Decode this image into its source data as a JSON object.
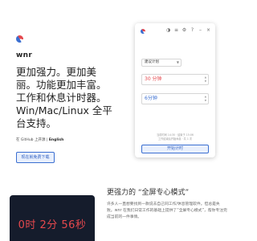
{
  "brand": "wnr",
  "headline": "更加强力。更加美丽。功能更加丰富。工作和休息计时器。Win/Mac/Linux 全平台支持。",
  "links": {
    "prefix": "在 GitHub 上开源 | ",
    "english": "English"
  },
  "download_button": "现在就免费下载",
  "app": {
    "select_value": "建议计划",
    "work_time": "30 分钟",
    "rest_time": "6分钟",
    "info_line1": "当前时间 14:30 · 结束于 15:06",
    "info_line2": "工作结束后开始休息 · 共 1 次",
    "start_button": "开始计时"
  },
  "section": {
    "title": "更强力的 “全屏专心模式”",
    "description": "许多人一直想要找到一款说去自己同工作/休息管理软件。但总是失败。wnr 在我们日常工作的基础上提供了“全屏专心模式”，帮你专注完成当前的一件事情。"
  },
  "dark_panel": {
    "time_text": "0时 2分 56秒"
  },
  "colors": {
    "accent_blue": "#3b6fd1",
    "accent_red": "#e5484d",
    "dark_panel": "#151c2c"
  },
  "icons": {
    "logo": "wnr-logo-icon",
    "titlebar": [
      "contrast-icon",
      "list-icon",
      "gear-icon",
      "help-icon",
      "minimize-icon",
      "close-icon"
    ]
  }
}
